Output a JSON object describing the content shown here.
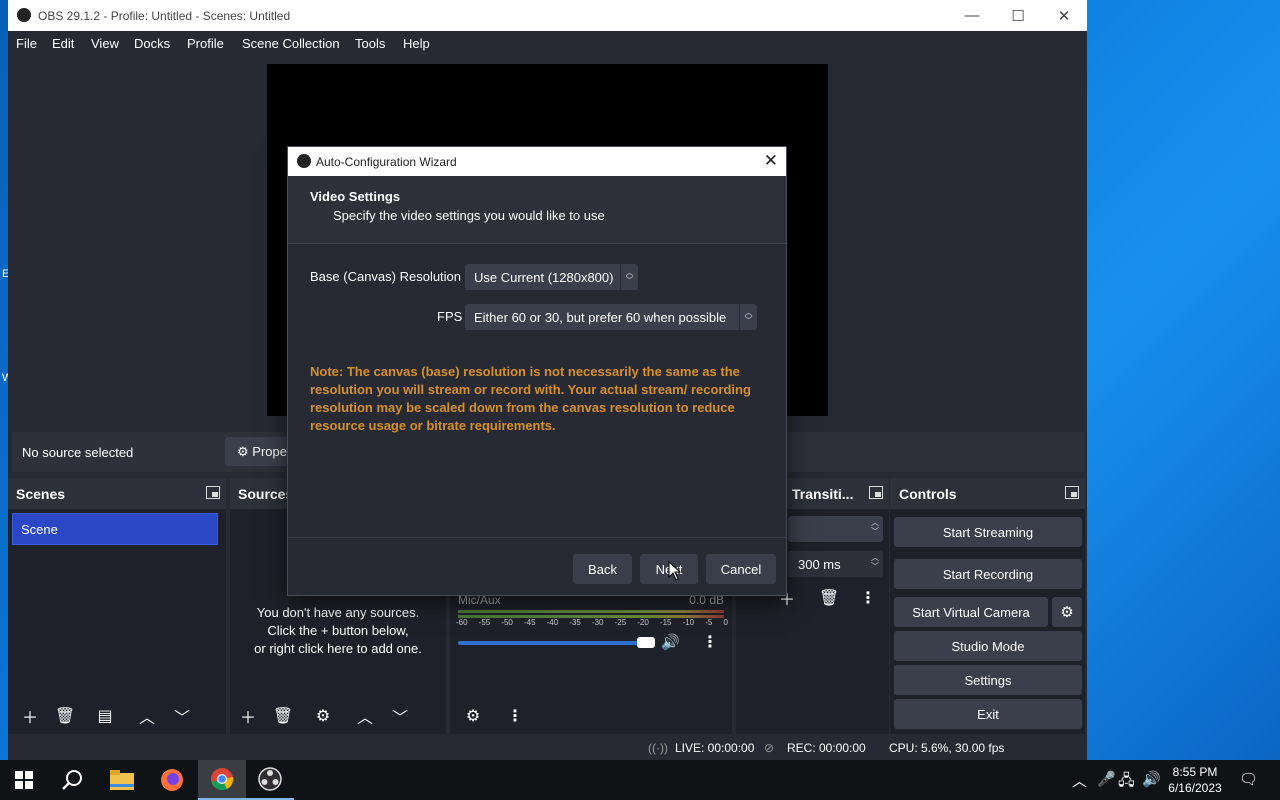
{
  "window": {
    "title": "OBS 29.1.2 - Profile: Untitled - Scenes: Untitled",
    "minimize": "—",
    "maximize": "☐",
    "close": "✕"
  },
  "menu": [
    "File",
    "Edit",
    "View",
    "Docks",
    "Profile",
    "Scene Collection",
    "Tools",
    "Help"
  ],
  "source_bar": {
    "no_source": "No source selected",
    "properties_label": "Prope"
  },
  "scenes": {
    "title": "Scenes",
    "items": [
      "Scene"
    ]
  },
  "sources": {
    "title": "Sources",
    "empty_line1": "You don't have any sources.",
    "empty_line2": "Click the + button below,",
    "empty_line3": "or right click here to add one."
  },
  "mixer": {
    "channel_name": "Mic/Aux",
    "db": "0.0 dB",
    "ticks": [
      "-60",
      "-55",
      "-50",
      "-45",
      "-40",
      "-35",
      "-30",
      "-25",
      "-20",
      "-15",
      "-10",
      "-5",
      "0"
    ],
    "volume_level": 1.0
  },
  "transitions": {
    "title": "Transiti...",
    "duration": "300 ms"
  },
  "controls": {
    "title": "Controls",
    "start_streaming": "Start Streaming",
    "start_recording": "Start Recording",
    "start_virtual_camera": "Start Virtual Camera",
    "studio_mode": "Studio Mode",
    "settings": "Settings",
    "exit": "Exit"
  },
  "status": {
    "live": "LIVE: 00:00:00",
    "rec": "REC: 00:00:00",
    "cpu": "CPU: 5.6%, 30.00 fps"
  },
  "dialog": {
    "title": "Auto-Configuration Wizard",
    "heading": "Video Settings",
    "subheading": "Specify the video settings you would like to use",
    "resolution_label": "Base (Canvas) Resolution",
    "resolution_value": "Use Current (1280x800)",
    "fps_label": "FPS",
    "fps_value": "Either 60 or 30, but prefer 60 when possible",
    "note": "Note: The canvas (base) resolution is not necessarily the same as the resolution you will stream or record with. Your actual stream/ recording resolution may be scaled down from the canvas resolution to reduce resource usage or bitrate requirements.",
    "back": "Back",
    "next": "Next",
    "cancel": "Cancel"
  },
  "taskbar": {
    "time": "8:55 PM",
    "date": "6/16/2023",
    "icons": [
      "start-icon",
      "search-icon",
      "file-explorer-icon",
      "firefox-icon",
      "chrome-icon",
      "obs-icon"
    ]
  },
  "colors": {
    "accent_selected": "#2a47c5",
    "note_text": "#d6902a",
    "panel_bg": "#272a33"
  }
}
